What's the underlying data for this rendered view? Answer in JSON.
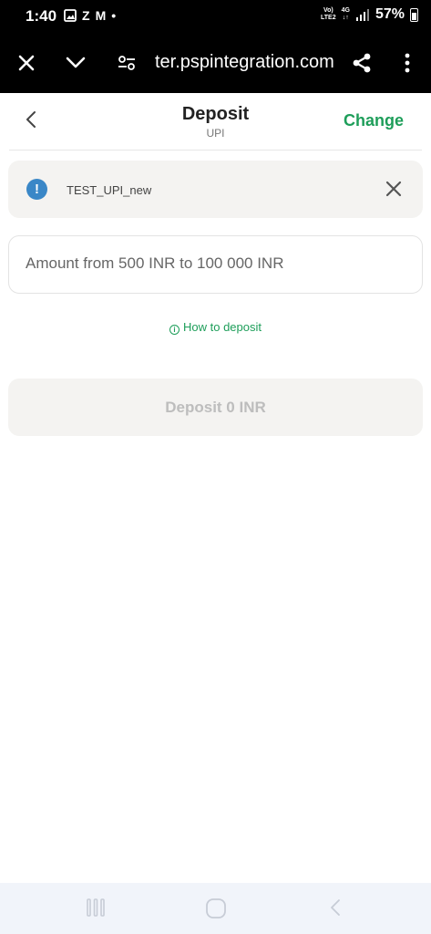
{
  "status_bar": {
    "time": "1:40",
    "icons_left": [
      "image-icon",
      "z-icon",
      "gmail-icon",
      "dot-icon"
    ],
    "z_glyph": "Z",
    "gmail_glyph": "M",
    "dot_glyph": "•",
    "network_top": "Vo)",
    "network_bottom": "LTE2",
    "signal_type": "4G",
    "battery_percent": "57%"
  },
  "browser": {
    "url": "ter.pspintegration.com"
  },
  "header": {
    "title": "Deposit",
    "subtitle": "UPI",
    "change_label": "Change"
  },
  "info_card": {
    "text": "TEST_UPI_new",
    "icon_glyph": "!"
  },
  "amount_field": {
    "placeholder": "Amount from 500 INR to 100 000 INR",
    "value": ""
  },
  "how_to_deposit": {
    "label": "How to deposit",
    "icon_glyph": "i"
  },
  "deposit_button": {
    "label": "Deposit 0 INR"
  },
  "colors": {
    "accent": "#1e9e5a",
    "info": "#3a87c7",
    "card_bg": "#f4f3f1",
    "disabled_text": "#bdbdbd"
  }
}
